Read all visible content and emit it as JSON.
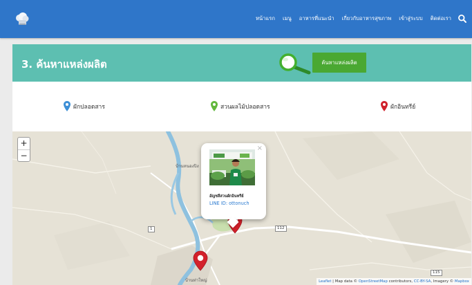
{
  "navbar": {
    "items": [
      {
        "label": "หน้าแรก"
      },
      {
        "label": "เมนู"
      },
      {
        "label": "อาหารที่แนะนำ"
      },
      {
        "label": "เกี่ยวกับอาหารสุขภาพ"
      },
      {
        "label": "เข้าสู่ระบบ"
      },
      {
        "label": "ติดต่อเรา"
      }
    ],
    "icon": "search-icon",
    "logo_icon": "chef-hat-icon",
    "color": "#2f76c9"
  },
  "section": {
    "title": "3. ค้นหาแหล่งผลิต",
    "button_label": "ค้นหาแหล่งผลิต",
    "header_color": "#5dbfb1",
    "button_color": "#4aa832"
  },
  "legend": [
    {
      "label": "ผักปลอดสาร",
      "color": "#3d8fd6",
      "icon": "map-pin-icon"
    },
    {
      "label": "สวนผลไม้ปลอดสาร",
      "color": "#63b83d",
      "icon": "map-pin-icon"
    },
    {
      "label": "ผักอินทรีย์",
      "color": "#d0222c",
      "icon": "map-pin-icon"
    }
  ],
  "map": {
    "zoom_in": "+",
    "zoom_out": "−",
    "place_labels": [
      "บ้านหนองปิง",
      "บ้านท่าใหญ่"
    ],
    "road_labels": [
      "112",
      "1",
      "115"
    ],
    "popup": {
      "name": "อัญชลีสวนผักอินทรีย์",
      "line_id": "LINE ID: ottonuch",
      "close": "×"
    },
    "attribution": {
      "leaflet": "Leaflet",
      "text_1": " | Map data © ",
      "osm": "OpenStreetMap",
      "text_2": " contributors, ",
      "license": "CC-BY-SA",
      "text_3": ", Imagery © ",
      "mapbox": "Mapbox"
    }
  }
}
